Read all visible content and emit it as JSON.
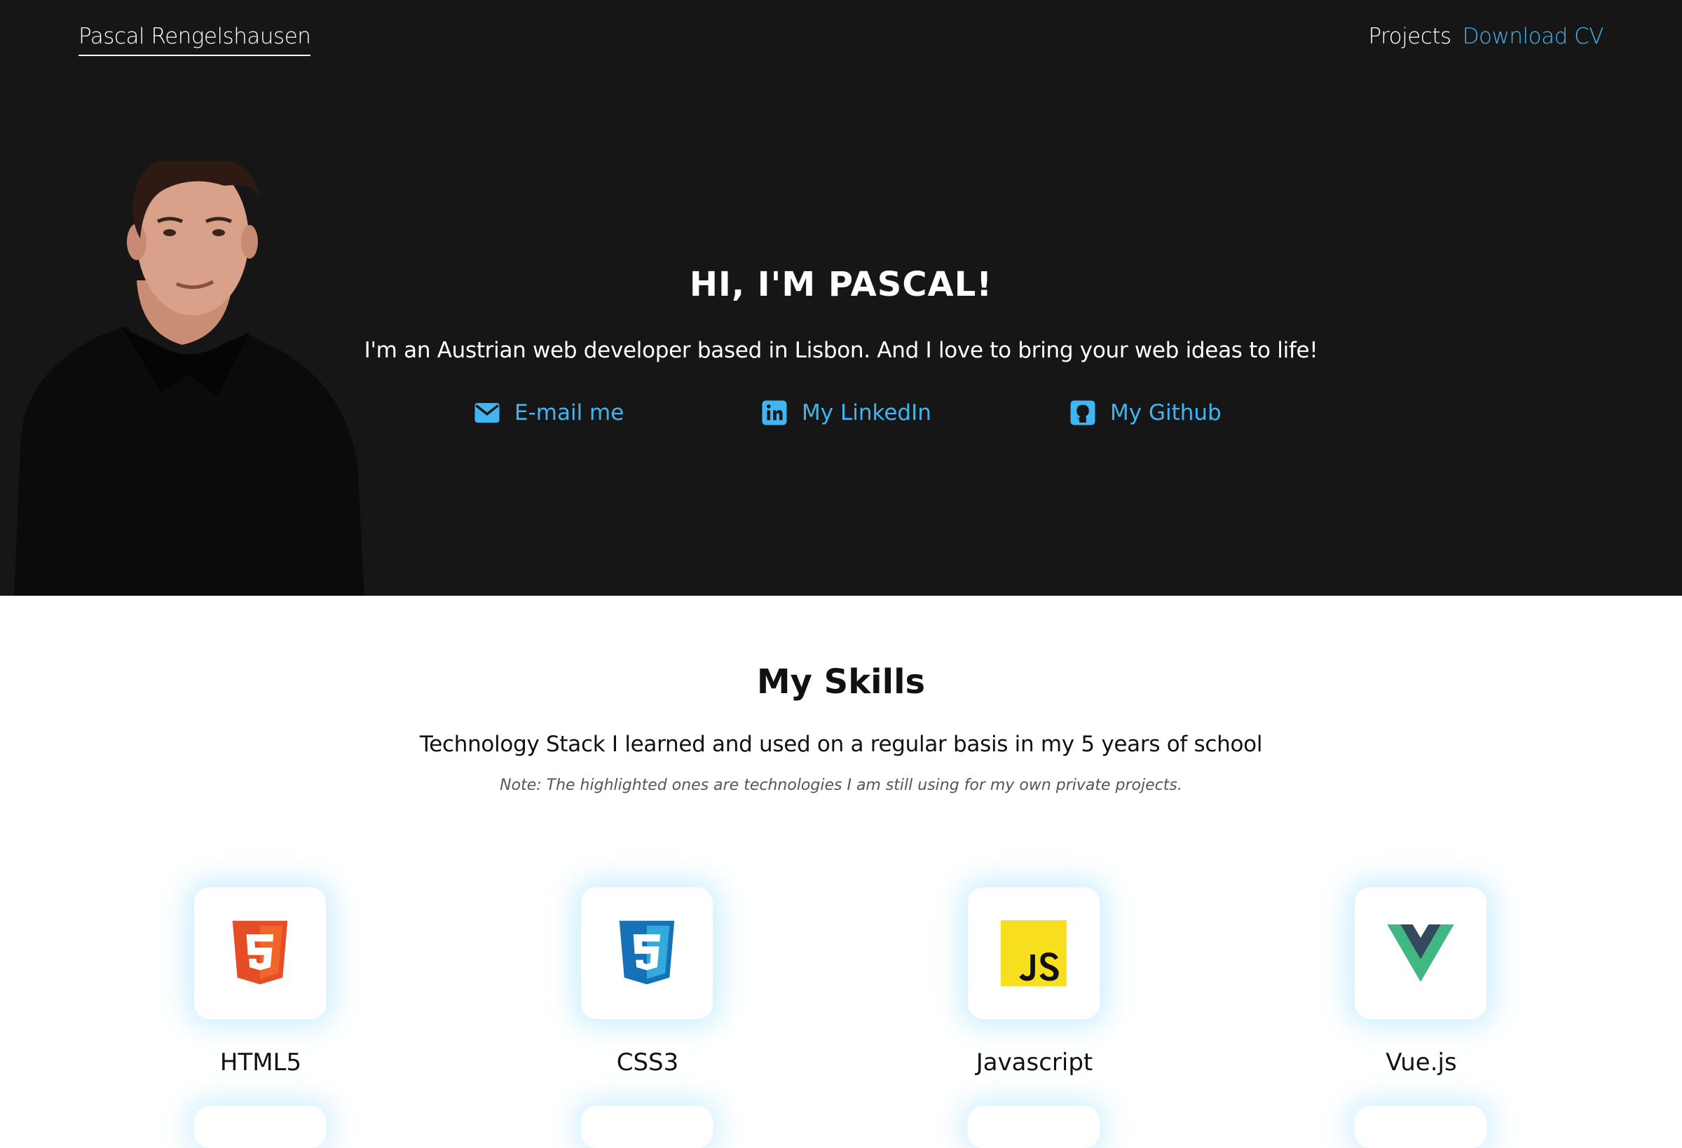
{
  "nav": {
    "brand": "Pascal Rengelshausen",
    "links": [
      "Projects",
      "Download CV"
    ]
  },
  "hero": {
    "title": "HI, I'M PASCAL!",
    "subtitle": "I'm an Austrian web developer based in Lisbon. And I love to bring your web ideas to life!",
    "contacts": [
      {
        "label": "E-mail me",
        "icon": "mail-icon"
      },
      {
        "label": "My LinkedIn",
        "icon": "linkedin-icon"
      },
      {
        "label": "My Github",
        "icon": "github-icon"
      }
    ]
  },
  "skills": {
    "title": "My Skills",
    "subtitle": "Technology Stack I learned and used on a regular basis in my 5 years of school",
    "note": "Note: The highlighted ones are technologies I am still using for my own private projects.",
    "items": [
      {
        "label": "HTML5",
        "icon": "html5-icon"
      },
      {
        "label": "CSS3",
        "icon": "css3-icon"
      },
      {
        "label": "Javascript",
        "icon": "javascript-icon"
      },
      {
        "label": "Vue.js",
        "icon": "vuejs-icon"
      }
    ]
  },
  "colors": {
    "accent": "#3fb6f2",
    "hero_bg": "#161616",
    "html5": "#e44d26",
    "css3": "#1572b6",
    "js": "#f7df1e",
    "vue_green": "#41b883",
    "vue_dark": "#35495e"
  }
}
